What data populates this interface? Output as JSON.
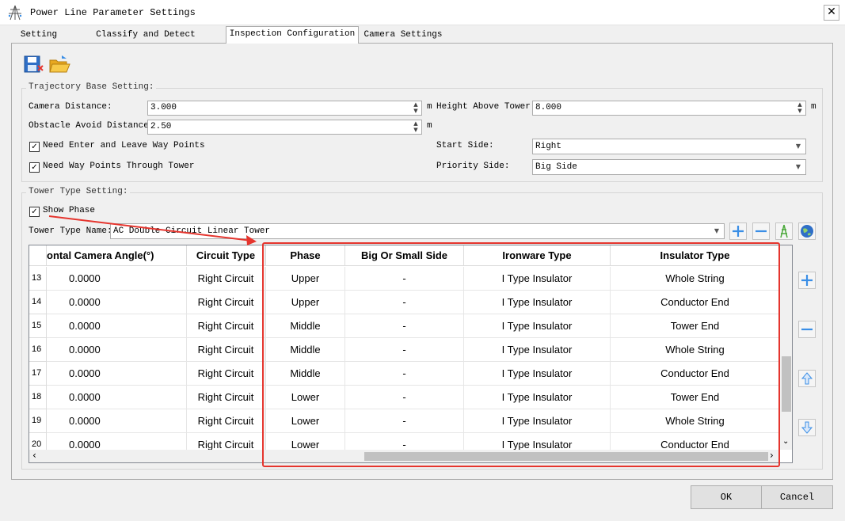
{
  "window": {
    "title": "Power Line Parameter Settings",
    "close_glyph": "✕"
  },
  "tabs": [
    {
      "label": "Setting"
    },
    {
      "label": "Classify and Detect Parameters"
    },
    {
      "label": "Inspection Configuration",
      "active": true
    },
    {
      "label": "Camera Settings"
    }
  ],
  "toolbar": {
    "save_icon": "save-icon",
    "open_icon": "open-folder-icon"
  },
  "trajectory": {
    "title": "Trajectory Base Setting:",
    "camera_distance_label": "Camera Distance:",
    "camera_distance_value": "3.000",
    "height_above_tower_label": "Height Above Tower:",
    "height_above_tower_value": "8.000",
    "obstacle_label": "Obstacle Avoid Distance:",
    "obstacle_value": "2.50",
    "unit": "m",
    "need_enter_leave_label": "Need Enter and Leave Way Points",
    "need_enter_leave_checked": true,
    "need_through_tower_label": "Need Way Points Through Tower",
    "need_through_tower_checked": true,
    "start_side_label": "Start Side:",
    "start_side_value": "Right",
    "priority_side_label": "Priority Side:",
    "priority_side_value": "Big Side"
  },
  "tower": {
    "title": "Tower Type Setting:",
    "show_phase_label": "Show Phase",
    "show_phase_checked": true,
    "tower_type_label": "Tower Type Name:",
    "tower_type_value": "AC Double Circuit Linear Tower"
  },
  "table": {
    "headers": [
      "ontal Camera Angle(°)",
      "Circuit Type",
      "Phase",
      "Big Or Small Side",
      "Ironware Type",
      "Insulator Type"
    ],
    "rows": [
      {
        "num": "13",
        "angle": "0.0000",
        "circuit": "Right Circuit",
        "phase": "Upper",
        "side": "-",
        "ironware": "I Type Insulator",
        "insulator": "Whole String"
      },
      {
        "num": "14",
        "angle": "0.0000",
        "circuit": "Right Circuit",
        "phase": "Upper",
        "side": "-",
        "ironware": "I Type Insulator",
        "insulator": "Conductor End"
      },
      {
        "num": "15",
        "angle": "0.0000",
        "circuit": "Right Circuit",
        "phase": "Middle",
        "side": "-",
        "ironware": "I Type Insulator",
        "insulator": "Tower End"
      },
      {
        "num": "16",
        "angle": "0.0000",
        "circuit": "Right Circuit",
        "phase": "Middle",
        "side": "-",
        "ironware": "I Type Insulator",
        "insulator": "Whole String"
      },
      {
        "num": "17",
        "angle": "0.0000",
        "circuit": "Right Circuit",
        "phase": "Middle",
        "side": "-",
        "ironware": "I Type Insulator",
        "insulator": "Conductor End"
      },
      {
        "num": "18",
        "angle": "0.0000",
        "circuit": "Right Circuit",
        "phase": "Lower",
        "side": "-",
        "ironware": "I Type Insulator",
        "insulator": "Tower End"
      },
      {
        "num": "19",
        "angle": "0.0000",
        "circuit": "Right Circuit",
        "phase": "Lower",
        "side": "-",
        "ironware": "I Type Insulator",
        "insulator": "Whole String"
      },
      {
        "num": "20",
        "angle": "0.0000",
        "circuit": "Right Circuit",
        "phase": "Lower",
        "side": "-",
        "ironware": "I Type Insulator",
        "insulator": "Conductor End"
      }
    ]
  },
  "footer": {
    "ok_label": "OK",
    "cancel_label": "Cancel"
  },
  "colors": {
    "highlight": "#e5352e",
    "accent_blue": "#3a8ee6"
  }
}
